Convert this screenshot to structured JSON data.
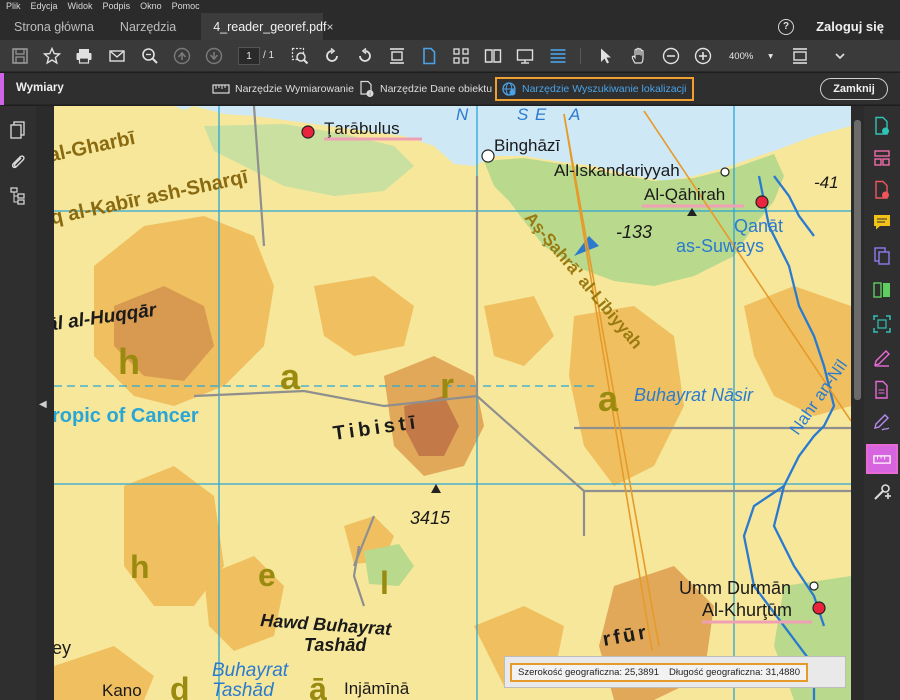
{
  "menu": [
    "Plik",
    "Edycja",
    "Widok",
    "Podpis",
    "Okno",
    "Pomoc"
  ],
  "tabs": {
    "home": "Strona główna",
    "tools": "Narzędzia",
    "document": "4_reader_georef.pdf",
    "close_glyph": "×"
  },
  "header": {
    "help_glyph": "?",
    "login": "Zaloguj się"
  },
  "toolbar": {
    "page_current": "1",
    "page_total": "/ 1",
    "zoom": "400%",
    "zoom_caret": "▾"
  },
  "measure_bar": {
    "title": "Wymiary",
    "tools": [
      {
        "label": "Narzędzie Wymiarowanie",
        "icon": "ruler-icon"
      },
      {
        "label": "Narzędzie Dane obiektu",
        "icon": "object-data-icon"
      },
      {
        "label": "Narzędzie Wyszukiwanie lokalizacji",
        "icon": "geo-location-icon",
        "active": true
      }
    ],
    "close": "Zamknij"
  },
  "collapse_glyph": "◀",
  "colors": {
    "accent": "#d164e6",
    "highlight": "#f0a030",
    "active_text": "#4aa3e8",
    "map_sea": "#cfe8f5",
    "map_land": "#f7e79a",
    "map_desert": "#f0c060",
    "map_green": "#b9d98c"
  },
  "map": {
    "labels": [
      "Ţarābulus",
      "Binghāzī",
      "Al-Iskandariyyah",
      "Al-Qāhirah",
      "-41",
      "Qanāt",
      "as-Suways",
      "-133",
      "Aş-Şahrā' al-Lībiyyah",
      "al-Gharbī",
      "q al-Kabīr ash-Sharqī",
      "āl al-Huqqār",
      "h",
      "a",
      "r",
      "a",
      "ropic of Cancer",
      "Tibistī",
      "3415",
      "Buhayrat Nāsir",
      "Nahr an-Nīl",
      "Umm Durmān",
      "Al-Khurţūm",
      "h",
      "e",
      "l",
      "Hawd Buhayrat",
      "Tashād",
      "Buhayrat",
      "Tashād",
      "Kano",
      "d",
      "ā",
      "Injāmīnā",
      "rfūr",
      "ey",
      "N",
      "S",
      "E",
      "A"
    ]
  },
  "coordinates": {
    "lat_label": "Szerokość geograficzna:",
    "lat_value": "25,3891",
    "lon_label": "Długość geograficzna:",
    "lon_value": "31,4880"
  }
}
